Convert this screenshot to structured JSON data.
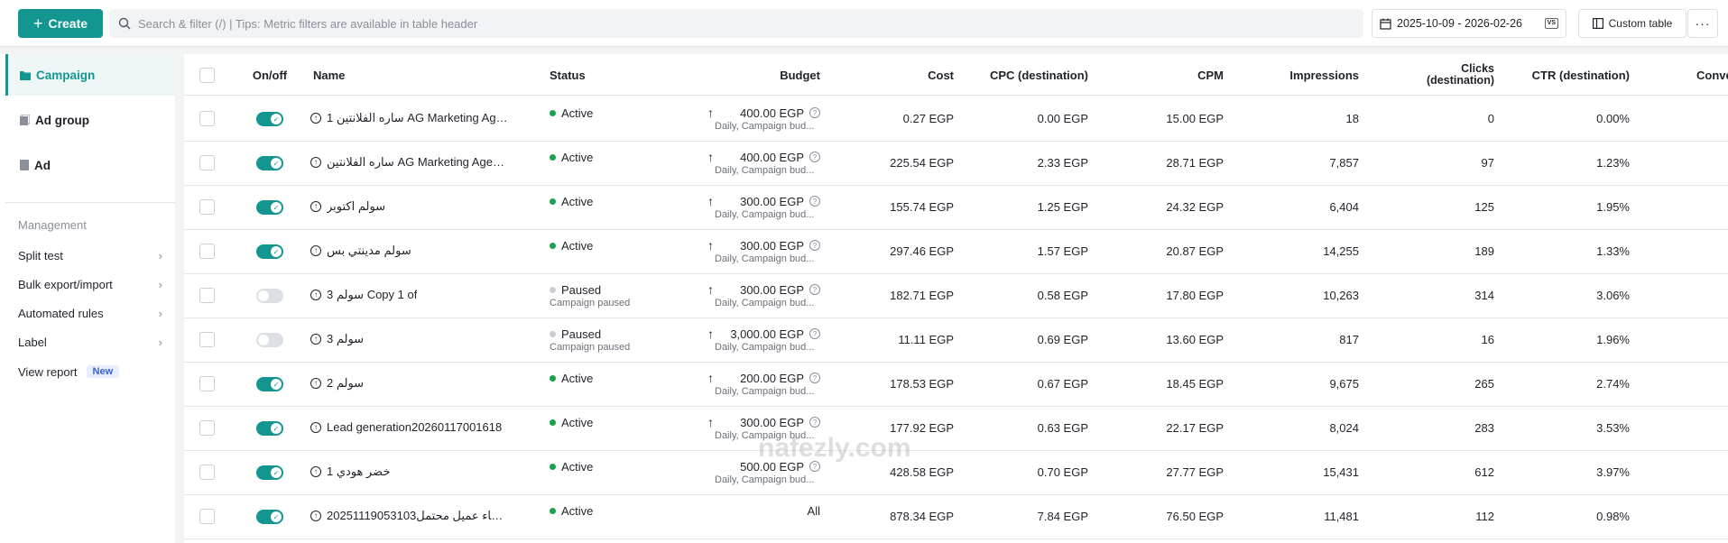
{
  "toolbar": {
    "create_label": "Create",
    "search_placeholder": "Search & filter (/) | Tips: Metric filters are available in table header",
    "date_range": "2025-10-09 - 2026-02-26",
    "compare_badge": "VS",
    "custom_table_label": "Custom table",
    "more_label": "···"
  },
  "sidebar": {
    "levels": [
      {
        "label": "Campaign",
        "active": true
      },
      {
        "label": "Ad group",
        "active": false
      },
      {
        "label": "Ad",
        "active": false
      }
    ],
    "management_title": "Management",
    "management_items": [
      {
        "label": "Split test",
        "chevron": "›"
      },
      {
        "label": "Bulk export/import",
        "chevron": "›"
      },
      {
        "label": "Automated rules",
        "chevron": "›"
      },
      {
        "label": "Label",
        "chevron": "›"
      }
    ],
    "view_report": {
      "label": "View report",
      "badge": "New"
    }
  },
  "table": {
    "headers": {
      "onoff": "On/off",
      "name": "Name",
      "status": "Status",
      "budget": "Budget",
      "cost": "Cost",
      "cpc": "CPC (destination)",
      "cpm": "CPM",
      "impressions": "Impressions",
      "clicks_line1": "Clicks",
      "clicks_line2": "(destination)",
      "ctr": "CTR (destination)",
      "conv": "Conve"
    },
    "rows": [
      {
        "on": true,
        "name": "ساره الفلانتين 1 AG Marketing Age...",
        "status": "Active",
        "status_sub": "",
        "budget_arrow": "↑",
        "budget": "400.00 EGP",
        "budget_sub": "Daily, Campaign bud...",
        "cost": "0.27 EGP",
        "cpc": "0.00 EGP",
        "cpm": "15.00 EGP",
        "impressions": "18",
        "clicks": "0",
        "ctr": "0.00%"
      },
      {
        "on": true,
        "name": "ساره الفلانتين AG Marketing Agency",
        "status": "Active",
        "status_sub": "",
        "budget_arrow": "↑",
        "budget": "400.00 EGP",
        "budget_sub": "Daily, Campaign bud...",
        "cost": "225.54 EGP",
        "cpc": "2.33 EGP",
        "cpm": "28.71 EGP",
        "impressions": "7,857",
        "clicks": "97",
        "ctr": "1.23%"
      },
      {
        "on": true,
        "name": "سولم اكتوبر",
        "status": "Active",
        "status_sub": "",
        "budget_arrow": "↑",
        "budget": "300.00 EGP",
        "budget_sub": "Daily, Campaign bud...",
        "cost": "155.74 EGP",
        "cpc": "1.25 EGP",
        "cpm": "24.32 EGP",
        "impressions": "6,404",
        "clicks": "125",
        "ctr": "1.95%"
      },
      {
        "on": true,
        "name": "سولم مدينتي بس",
        "status": "Active",
        "status_sub": "",
        "budget_arrow": "↑",
        "budget": "300.00 EGP",
        "budget_sub": "Daily, Campaign bud...",
        "cost": "297.46 EGP",
        "cpc": "1.57 EGP",
        "cpm": "20.87 EGP",
        "impressions": "14,255",
        "clicks": "189",
        "ctr": "1.33%"
      },
      {
        "on": false,
        "name": "سولم 3 Copy 1 of",
        "status": "Paused",
        "status_sub": "Campaign paused",
        "budget_arrow": "↑",
        "budget": "300.00 EGP",
        "budget_sub": "Daily, Campaign bud...",
        "cost": "182.71 EGP",
        "cpc": "0.58 EGP",
        "cpm": "17.80 EGP",
        "impressions": "10,263",
        "clicks": "314",
        "ctr": "3.06%"
      },
      {
        "on": false,
        "name": "سولم 3",
        "status": "Paused",
        "status_sub": "Campaign paused",
        "budget_arrow": "↑",
        "budget": "3,000.00 EGP",
        "budget_sub": "Daily, Campaign bud...",
        "cost": "11.11 EGP",
        "cpc": "0.69 EGP",
        "cpm": "13.60 EGP",
        "impressions": "817",
        "clicks": "16",
        "ctr": "1.96%"
      },
      {
        "on": true,
        "name": "سولم 2",
        "status": "Active",
        "status_sub": "",
        "budget_arrow": "↑",
        "budget": "200.00 EGP",
        "budget_sub": "Daily, Campaign bud...",
        "cost": "178.53 EGP",
        "cpc": "0.67 EGP",
        "cpm": "18.45 EGP",
        "impressions": "9,675",
        "clicks": "265",
        "ctr": "2.74%"
      },
      {
        "on": true,
        "name": "Lead generation20260117001618",
        "status": "Active",
        "status_sub": "",
        "budget_arrow": "↑",
        "budget": "300.00 EGP",
        "budget_sub": "Daily, Campaign bud...",
        "cost": "177.92 EGP",
        "cpc": "0.63 EGP",
        "cpm": "22.17 EGP",
        "impressions": "8,024",
        "clicks": "283",
        "ctr": "3.53%"
      },
      {
        "on": true,
        "name": "خضر هودي 1",
        "status": "Active",
        "status_sub": "",
        "budget_arrow": "",
        "budget": "500.00 EGP",
        "budget_sub": "Daily, Campaign bud...",
        "cost": "428.58 EGP",
        "cpc": "0.70 EGP",
        "cpm": "27.77 EGP",
        "impressions": "15,431",
        "clicks": "612",
        "ctr": "3.97%"
      },
      {
        "on": true,
        "name": "إنشاء عميل محتمل20251119053103...",
        "status": "Active",
        "status_sub": "",
        "budget_arrow": "",
        "budget": "All",
        "budget_sub": "",
        "cost": "878.34 EGP",
        "cpc": "7.84 EGP",
        "cpm": "76.50 EGP",
        "impressions": "11,481",
        "clicks": "112",
        "ctr": "0.98%"
      }
    ]
  },
  "watermark": "nafezly.com",
  "colors": {
    "accent": "#12968f",
    "active_dot": "#1aa34a",
    "paused_dot": "#c9cdd4"
  }
}
